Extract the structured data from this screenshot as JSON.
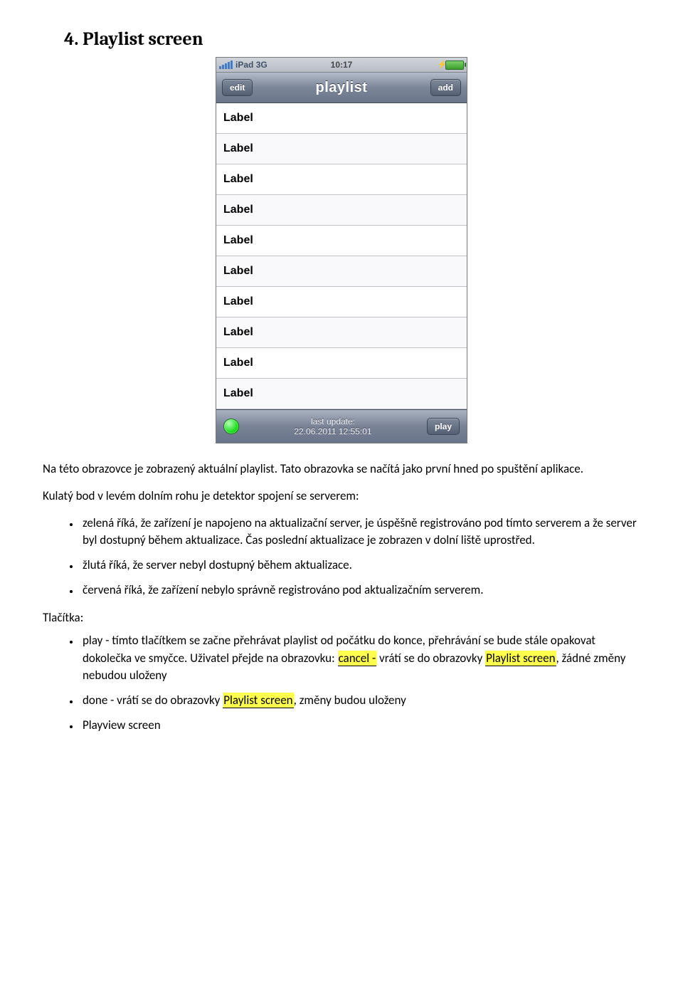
{
  "heading": "4. Playlist screen",
  "mockup": {
    "statusbar": {
      "carrier": "iPad",
      "network": "3G",
      "time": "10:17"
    },
    "navbar": {
      "left": "edit",
      "title": "playlist",
      "right": "add"
    },
    "rows": [
      "Label",
      "Label",
      "Label",
      "Label",
      "Label",
      "Label",
      "Label",
      "Label",
      "Label",
      "Label"
    ],
    "footer": {
      "status_color": "green",
      "last_update_caption": "last update:",
      "last_update_value": "22.06.2011 12:55:01",
      "play": "play"
    }
  },
  "intro1": "Na této obrazovce je zobrazený aktuální playlist. Tato obrazovka se načítá jako první hned po spuštění aplikace.",
  "intro2": "Kulatý bod v levém dolním rohu je detektor spojení se serverem:",
  "detector": {
    "green": "zelená říká, že zařízení je napojeno na aktualizační server,  je úspěšně registrováno pod tímto serverem a že  server byl dostupný během aktualizace. Čas poslední aktualizace je zobrazen v dolní liště uprostřed.",
    "yellow": "žlutá říká, že server nebyl dostupný během aktualizace.",
    "red": "červená říká, že zařízení nebylo správně registrováno pod aktualizačním serverem."
  },
  "buttons_label": "Tlačítka:",
  "buttons": {
    "play_pre": "play - tímto tlačítkem se začne přehrávat playlist od počátku do konce, přehrávání se bude stále opakovat dokolečka ve smyčce. Uživatel přejde na obrazovku: ",
    "play_hl1": "cancel -",
    "play_mid": " vrátí se do obrazovky ",
    "play_hl2": "Playlist screen",
    "play_post": ", žádné změny nebudou uloženy",
    "done_pre": "done - vrátí se do obrazovky ",
    "done_hl": "Playlist screen",
    "done_post": ", změny budou uloženy",
    "playview": "Playview screen"
  }
}
